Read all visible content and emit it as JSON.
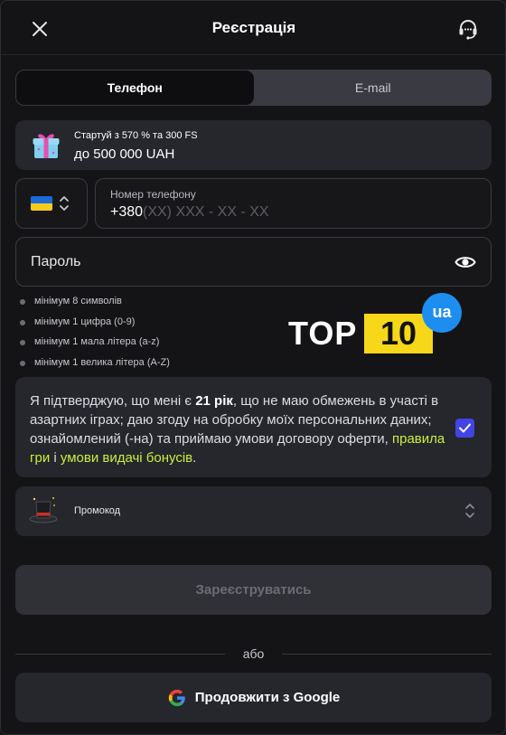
{
  "header": {
    "title": "Реєстрація"
  },
  "tabs": [
    {
      "label": "Телефон",
      "active": true
    },
    {
      "label": "E-mail",
      "active": false
    }
  ],
  "bonus": {
    "line1": "Стартуй з 570 % та 300 FS",
    "line2": "до 500 000 UAH",
    "icon": "gift-icon"
  },
  "country": {
    "flag": "ukraine-flag-icon"
  },
  "phone": {
    "label": "Номер телефону",
    "prefix": "+380",
    "mask": "(XX) XXX - XX - XX"
  },
  "password": {
    "label": "Пароль",
    "icon": "eye-icon"
  },
  "rules": [
    "мінімум 8 символів",
    "мінімум 1 цифра (0-9)",
    "мінімум 1 мала літера (a-z)",
    "мінімум 1 велика літера (A-Z)"
  ],
  "watermark": {
    "top": "TOP",
    "ten": "10",
    "ua": "ua"
  },
  "consent": {
    "part1": "Я підтверджую, що мені є ",
    "age": "21 рік",
    "part2": ", що не маю обмежень в участі в азартних іграх; даю згоду на обробку моїх персональних даних; ознайомлений (-на) та приймаю умови договору оферти, ",
    "link1": "правила гри",
    "part3": " і ",
    "link2": "умови видачі бонусів",
    "part4": ".",
    "checked": true
  },
  "promo": {
    "label": "Промокод",
    "icon": "magic-hat-icon"
  },
  "register": {
    "label": "Зареєструватись"
  },
  "divider": {
    "label": "або"
  },
  "google": {
    "label": "Продовжити з Google",
    "icon": "google-icon"
  },
  "colors": {
    "accent": "#4145e6",
    "link": "#c9f03a",
    "background": "#141417",
    "card": "#26262d"
  }
}
